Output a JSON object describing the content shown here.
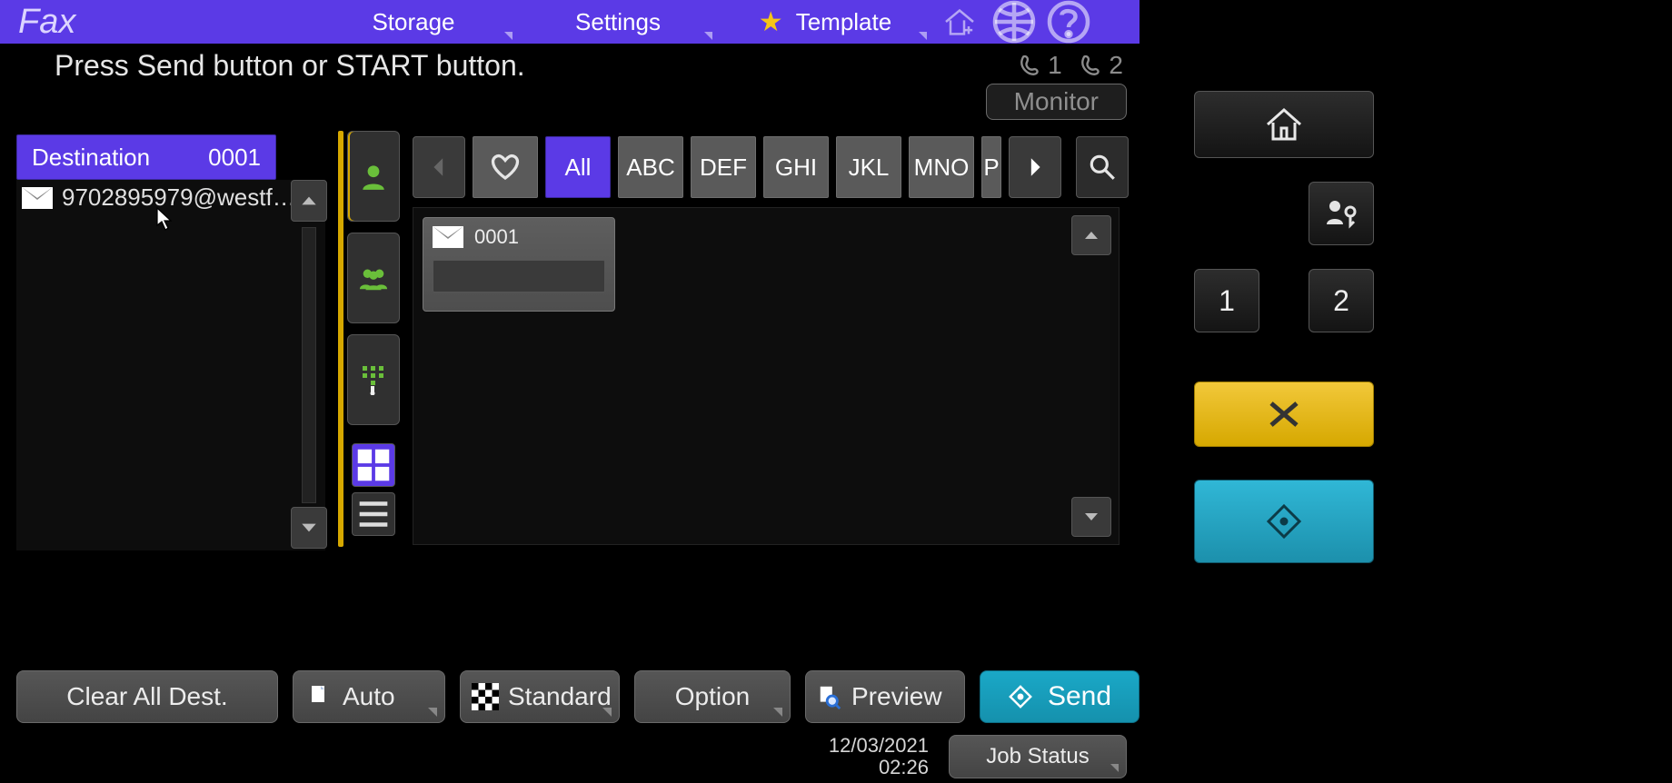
{
  "header": {
    "app_title": "Fax",
    "tabs": {
      "storage": "Storage",
      "settings": "Settings",
      "template": "Template"
    }
  },
  "instruction": "Press Send button or START button.",
  "lines": {
    "l1": "1",
    "l2": "2"
  },
  "monitor_label": "Monitor",
  "destination": {
    "title": "Destination",
    "count": "0001",
    "items": [
      "9702895979@westf…"
    ]
  },
  "address_book": {
    "tabs": [
      "All",
      "ABC",
      "DEF",
      "GHI",
      "JKL",
      "MNO",
      "P"
    ],
    "card": {
      "id": "0001"
    }
  },
  "buttons": {
    "clear": "Clear All Dest.",
    "auto": "Auto",
    "standard": "Standard",
    "option": "Option",
    "preview": "Preview",
    "send": "Send",
    "job_status": "Job Status"
  },
  "datetime": {
    "date": "12/03/2021",
    "time": "02:26"
  },
  "hw": {
    "one": "1",
    "two": "2"
  }
}
